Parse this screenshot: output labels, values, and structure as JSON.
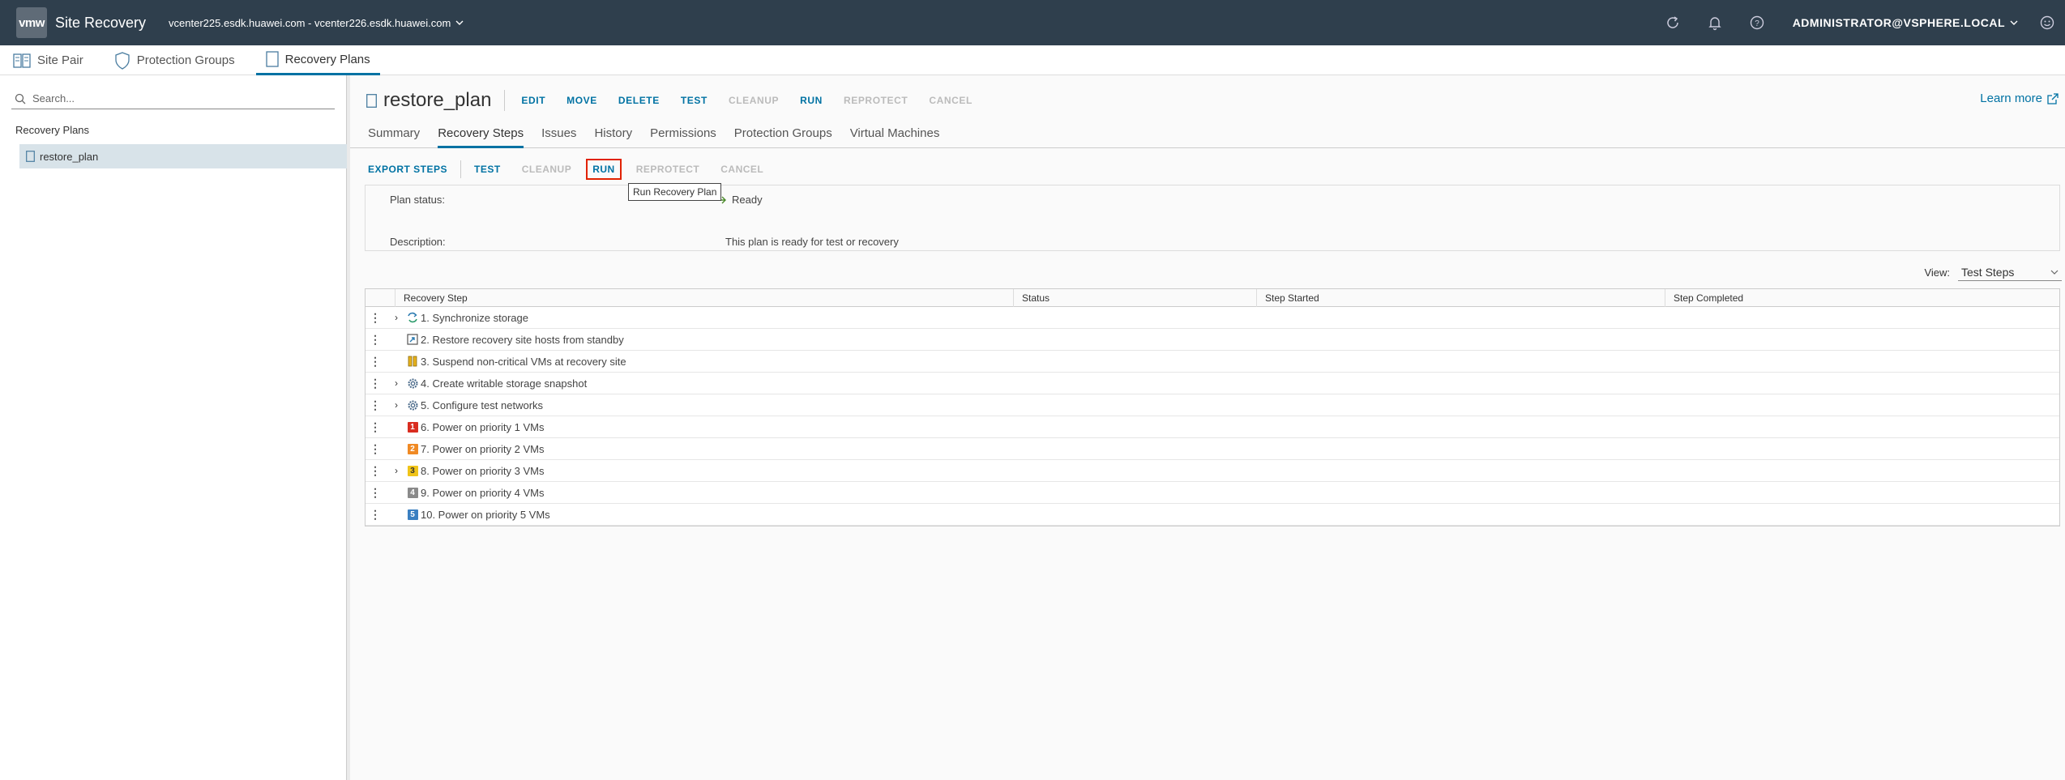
{
  "header": {
    "logo_text": "vmw",
    "app_title": "Site Recovery",
    "site_pair": "vcenter225.esdk.huawei.com - vcenter226.esdk.huawei.com",
    "user": "Administrator@VSPHERE.LOCAL"
  },
  "nav": {
    "tabs": [
      {
        "label": "Site Pair",
        "icon": "site-pair-icon"
      },
      {
        "label": "Protection Groups",
        "icon": "shield-icon"
      },
      {
        "label": "Recovery Plans",
        "icon": "plan-icon",
        "active": true
      }
    ]
  },
  "sidebar": {
    "search_placeholder": "Search...",
    "header": "Recovery Plans",
    "items": [
      {
        "label": "restore_plan",
        "selected": true
      }
    ]
  },
  "plan": {
    "title": "restore_plan",
    "actions": [
      {
        "label": "EDIT",
        "enabled": true
      },
      {
        "label": "MOVE",
        "enabled": true
      },
      {
        "label": "DELETE",
        "enabled": true
      },
      {
        "label": "TEST",
        "enabled": true
      },
      {
        "label": "CLEANUP",
        "enabled": false
      },
      {
        "label": "RUN",
        "enabled": true
      },
      {
        "label": "REPROTECT",
        "enabled": false
      },
      {
        "label": "CANCEL",
        "enabled": false
      }
    ],
    "learn_more": "Learn more"
  },
  "subtabs": [
    "Summary",
    "Recovery Steps",
    "Issues",
    "History",
    "Permissions",
    "Protection Groups",
    "Virtual Machines"
  ],
  "active_subtab": "Recovery Steps",
  "toolbar": {
    "export": "EXPORT STEPS",
    "test": "TEST",
    "cleanup": "CLEANUP",
    "run": "RUN",
    "reprotect": "REPROTECT",
    "cancel": "CANCEL",
    "tooltip": "Run Recovery Plan"
  },
  "status": {
    "plan_status_label": "Plan status:",
    "plan_status_value": "Ready",
    "description_label": "Description:",
    "description_value": "This plan is ready for test or recovery"
  },
  "view": {
    "label": "View:",
    "selected": "Test Steps"
  },
  "grid": {
    "columns": [
      "Recovery Step",
      "Status",
      "Step Started",
      "Step Completed"
    ],
    "rows": [
      {
        "step": "1. Synchronize storage",
        "expandable": true,
        "icon": "sync-icon"
      },
      {
        "step": "2. Restore recovery site hosts from standby",
        "expandable": false,
        "icon": "host-restore-icon"
      },
      {
        "step": "3. Suspend non-critical VMs at recovery site",
        "expandable": false,
        "icon": "suspend-icon"
      },
      {
        "step": "4. Create writable storage snapshot",
        "expandable": true,
        "icon": "gear-icon"
      },
      {
        "step": "5. Configure test networks",
        "expandable": true,
        "icon": "gear-icon"
      },
      {
        "step": "6. Power on priority 1 VMs",
        "expandable": false,
        "icon": "priority-1-icon",
        "badge": "1",
        "color": "#d92d20"
      },
      {
        "step": "7. Power on priority 2 VMs",
        "expandable": false,
        "icon": "priority-2-icon",
        "badge": "2",
        "color": "#f08a24"
      },
      {
        "step": "8. Power on priority 3 VMs",
        "expandable": true,
        "icon": "priority-3-icon",
        "badge": "3",
        "color": "#f0c419"
      },
      {
        "step": "9. Power on priority 4 VMs",
        "expandable": false,
        "icon": "priority-4-icon",
        "badge": "4",
        "color": "#8a8a8a"
      },
      {
        "step": "10. Power on priority 5 VMs",
        "expandable": false,
        "icon": "priority-5-icon",
        "badge": "5",
        "color": "#3a7fc1"
      }
    ]
  }
}
